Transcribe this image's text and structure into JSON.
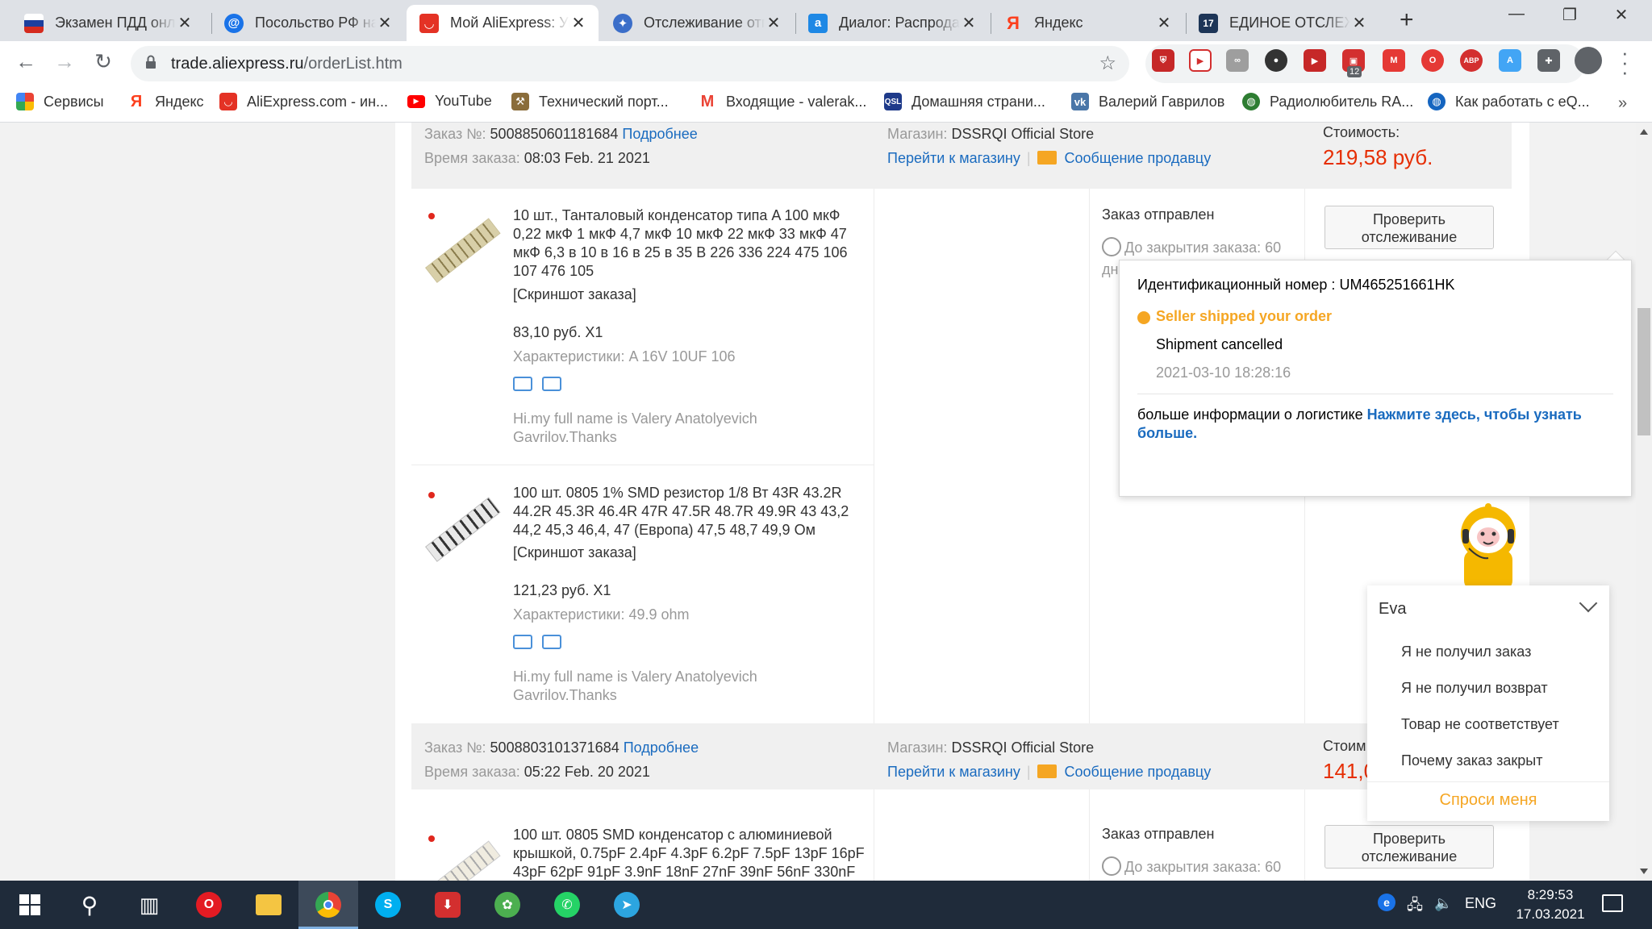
{
  "browser": {
    "tabs": [
      {
        "title": "Экзамен ПДД онлайн",
        "favicon": "russia-flag-icon",
        "color": "#d52b1e",
        "active": false
      },
      {
        "title": "Посольство РФ на",
        "favicon": "at-sign-icon",
        "color": "#1a73e8",
        "active": false
      },
      {
        "title": "Мой AliExpress: Управление",
        "favicon": "aliexpress-icon",
        "color": "#e43225",
        "active": true
      },
      {
        "title": "Отслеживание отправлений",
        "favicon": "eagle-emblem-icon",
        "color": "#3b6ec9",
        "active": false
      },
      {
        "title": "Диалог: Распродажа",
        "favicon": "ali-logo-icon",
        "color": "#1e88e5",
        "active": false
      },
      {
        "title": "Яндекс",
        "favicon": "yandex-icon",
        "color": "#fc3f1d",
        "active": false
      },
      {
        "title": "ЕДИНОЕ ОТСЛЕЖИВАНИЕ",
        "favicon": "17track-icon",
        "color": "#1d3557",
        "active": false
      }
    ],
    "url_host": "trade.aliexpress.ru",
    "url_path": "/orderList.htm",
    "extension_badge": "12",
    "bookmarks": [
      {
        "label": "Сервисы",
        "icon": "apps-grid-icon",
        "color": "#4285f4"
      },
      {
        "label": "Яндекс",
        "icon": "yandex-icon",
        "color": "#fc3f1d"
      },
      {
        "label": "AliExpress.com - ин...",
        "icon": "aliexpress-icon",
        "color": "#e43225"
      },
      {
        "label": "YouTube",
        "icon": "youtube-icon",
        "color": "#ff0000"
      },
      {
        "label": "Технический порт...",
        "icon": "tech-portal-icon",
        "color": "#8a6d3b"
      },
      {
        "label": "Входящие - valerak...",
        "icon": "gmail-icon",
        "color": "#ea4335"
      },
      {
        "label": "Домашняя страни...",
        "icon": "qsl-icon",
        "color": "#1e3a8a"
      },
      {
        "label": "Валерий Гаврилов",
        "icon": "vk-icon",
        "color": "#4a76a8"
      },
      {
        "label": "Радиолюбитель RA...",
        "icon": "globe-icon",
        "color": "#2e7d32"
      },
      {
        "label": "Как работать с eQ...",
        "icon": "globe-icon",
        "color": "#1565c0"
      }
    ]
  },
  "labels": {
    "order_no": "Заказ №:",
    "details": "Подробнее",
    "order_time": "Время заказа:",
    "store": "Магазин:",
    "go_store": "Перейти к магазину",
    "message_seller": "Сообщение продавцу",
    "cost": "Стоимость:",
    "cost_cut": "Стоим",
    "screenshot": "[Скриншот заказа]",
    "status_shipped": "Заказ отправлен",
    "countdown": "До закрытия заказа: 60",
    "countdown_wrap": "дн",
    "track_line1": "Проверить",
    "track_line2": "отслеживание"
  },
  "orders": [
    {
      "number": "5008850601181684",
      "time": "08:03 Feb. 21 2021",
      "store": "DSSRQI Official Store",
      "price": "219,58 руб."
    },
    {
      "number": "5008803101371684",
      "time": "05:22 Feb. 20 2021",
      "store": "DSSRQI Official Store",
      "price": "141,0"
    }
  ],
  "items": [
    {
      "title": "10 шт., Танталовый конденсатор типа A 100 мкФ 0,22 мкФ 1 мкФ 4,7 мкФ 10 мкФ 22 мкФ 33 мкФ 47 мкФ 6,3 в 10 в 16 в 25 в 35 В 226 336 224 475 106 107 476 105",
      "price": "83,10 руб. X1",
      "specs": "Характеристики: A 16V 10UF 106",
      "note": "Hi.my full name is Valery Anatolyevich Gavrilov.Thanks"
    },
    {
      "title": "100 шт. 0805 1% SMD резистор 1/8 Вт 43R 43.2R 44.2R 45.3R 46.4R 47R 47.5R 48.7R 49.9R 43 43,2 44,2 45,3 46,4, 47 (Европа) 47,5 48,7 49,9 Ом",
      "price": "121,23 руб. X1",
      "specs": "Характеристики: 49.9 ohm",
      "note": "Hi.my full name is Valery Anatolyevich Gavrilov.Thanks"
    },
    {
      "title": "100 шт. 0805 SMD конденсатор с алюминиевой крышкой, 0.75pF 2.4pF 4.3pF 6.2pF 7.5pF 13pF 16pF 43pF 62pF 91pF 3.9nF 18nF 27nF 39nF 56nF 330nF"
    }
  ],
  "tracking_popup": {
    "id_label": "Идентификационный номер :",
    "id_value": "UM465251661HK",
    "event": "Seller shipped your order",
    "status": "Shipment cancelled",
    "timestamp": "2021-03-10 18:28:16",
    "more_prefix": "больше информации о логистике",
    "more_link": "Нажмите здесь, чтобы узнать больше."
  },
  "eva": {
    "title": "Eva",
    "options": [
      "Я не получил заказ",
      "Я не получил возврат",
      "Товар не соответствует",
      "Почему заказ закрыт"
    ],
    "ask": "Спроси меня"
  },
  "taskbar": {
    "lang": "ENG",
    "time": "8:29:53",
    "date": "17.03.2021"
  }
}
